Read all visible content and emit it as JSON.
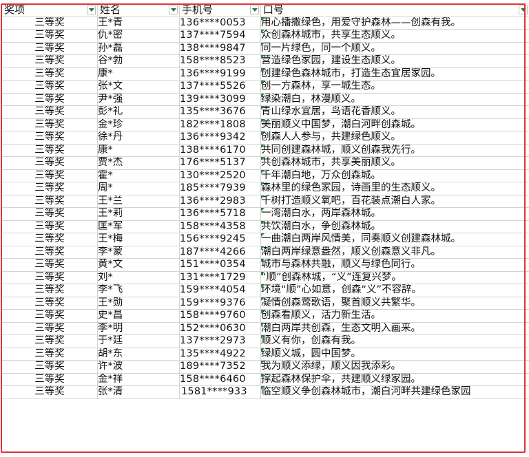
{
  "headers": {
    "award": "奖项",
    "name": "姓名",
    "phone": "手机号",
    "slogan": "口号"
  },
  "icons": {
    "filter": "filter-dropdown-icon",
    "comment": "cell-comment-marker-icon"
  },
  "colors": {
    "selection_border": "#e23232",
    "filter_arrow": "#1e7a3a",
    "comment_marker": "#1e8a3a",
    "gridline": "#d4d4d4"
  },
  "rows": [
    {
      "award": "三等奖",
      "name": "王*青",
      "phone": "136****0053",
      "slogan": "用心播撒绿色，用爱守护森林——创森有我。"
    },
    {
      "award": "三等奖",
      "name": "仇*密",
      "phone": "137****7594",
      "slogan": "众创森林城市，共享生态顺义。"
    },
    {
      "award": "三等奖",
      "name": "孙*磊",
      "phone": "138****9847",
      "slogan": "同一片绿色，同一个顺义。"
    },
    {
      "award": "三等奖",
      "name": "谷*勃",
      "phone": "158****8523",
      "slogan": "营造绿色家园，建设生态顺义。"
    },
    {
      "award": "三等奖",
      "name": "康*",
      "phone": "136****9199",
      "slogan": "创建绿色森林城市，打造生态宜居家园。"
    },
    {
      "award": "三等奖",
      "name": "张*文",
      "phone": "137****5526",
      "slogan": "创一方森林，享一城生态。"
    },
    {
      "award": "三等奖",
      "name": "尹*强",
      "phone": "139****3099",
      "slogan": "绿染潮白，林漫顺义。"
    },
    {
      "award": "三等奖",
      "name": "彭*礼",
      "phone": "135****3676",
      "slogan": "青山绿水宜居，鸟语花香顺义。"
    },
    {
      "award": "三等奖",
      "name": "金*珍",
      "phone": "182****1808",
      "slogan": "美丽顺义中国梦，潮白河畔创森城。"
    },
    {
      "award": "三等奖",
      "name": "徐*丹",
      "phone": "136****9342",
      "slogan": "创森人人参与，共建绿色顺义。"
    },
    {
      "award": "三等奖",
      "name": "康*",
      "phone": "138****6170",
      "slogan": "共同创建森林城，顺义创森我先行。"
    },
    {
      "award": "三等奖",
      "name": "贾*杰",
      "phone": "176****5137",
      "slogan": "共创森林城市，共享美丽顺义。"
    },
    {
      "award": "三等奖",
      "name": "霍*",
      "phone": "130****2520",
      "slogan": "千年潮白地，万众创森城。"
    },
    {
      "award": "三等奖",
      "name": "周*",
      "phone": "185****7939",
      "slogan": "森林里的绿色家园，诗画里的生态顺义。"
    },
    {
      "award": "三等奖",
      "name": "王*兰",
      "phone": "136****2983",
      "slogan": "千树打造顺义氧吧，百花装点潮白人家。"
    },
    {
      "award": "三等奖",
      "name": "王*莉",
      "phone": "136****5718",
      "slogan": "一湾潮白水，两岸森林城。"
    },
    {
      "award": "三等奖",
      "name": "匡*军",
      "phone": "158****4358",
      "slogan": "共饮潮白水，争创森林城。"
    },
    {
      "award": "三等奖",
      "name": "王*梅",
      "phone": "156****9245",
      "slogan": "一曲潮白两岸风情美，同奏顺义创建森林城。"
    },
    {
      "award": "三等奖",
      "name": "李*蒙",
      "phone": "187****4266",
      "slogan": "潮白两岸绿意盎然，顺义创森意义非凡。"
    },
    {
      "award": "三等奖",
      "name": "黄*文",
      "phone": "151****0354",
      "slogan": "城市与森林共融，顺义与绿色同行。"
    },
    {
      "award": "三等奖",
      "name": "刘*",
      "phone": "131****1729",
      "slogan": "“顺”创森林城，“义”连复兴梦。"
    },
    {
      "award": "三等奖",
      "name": "李*飞",
      "phone": "159****4054",
      "slogan": "环境“顺”心如意，创森“义”不容辞。"
    },
    {
      "award": "三等奖",
      "name": "王*勋",
      "phone": "159****9376",
      "slogan": "凝情创森莺歌语，聚首顺义共繁华。"
    },
    {
      "award": "三等奖",
      "name": "史*昌",
      "phone": "158****9760",
      "slogan": "创森看顺义，活力新生活。"
    },
    {
      "award": "三等奖",
      "name": "李*明",
      "phone": "152****0630",
      "slogan": "潮白两岸共创森，生态文明入画来。"
    },
    {
      "award": "三等奖",
      "name": "于*廷",
      "phone": "137****2973",
      "slogan": "顺义有你，创森有我。"
    },
    {
      "award": "三等奖",
      "name": "胡*东",
      "phone": "135****4922",
      "slogan": "绿顺义城，圆中国梦。"
    },
    {
      "award": "三等奖",
      "name": "许*波",
      "phone": "189****7352",
      "slogan": "我为顺义添绿，顺义因我添彩。"
    },
    {
      "award": "三等奖",
      "name": "金*祥",
      "phone": "158****6460",
      "slogan": "撑起森林保护伞，共建顺义绿家园。"
    },
    {
      "award": "三等奖",
      "name": "张*清",
      "phone": "1581****933",
      "slogan": "临空顺义争创森林城市，潮白河畔共建绿色家园"
    }
  ]
}
